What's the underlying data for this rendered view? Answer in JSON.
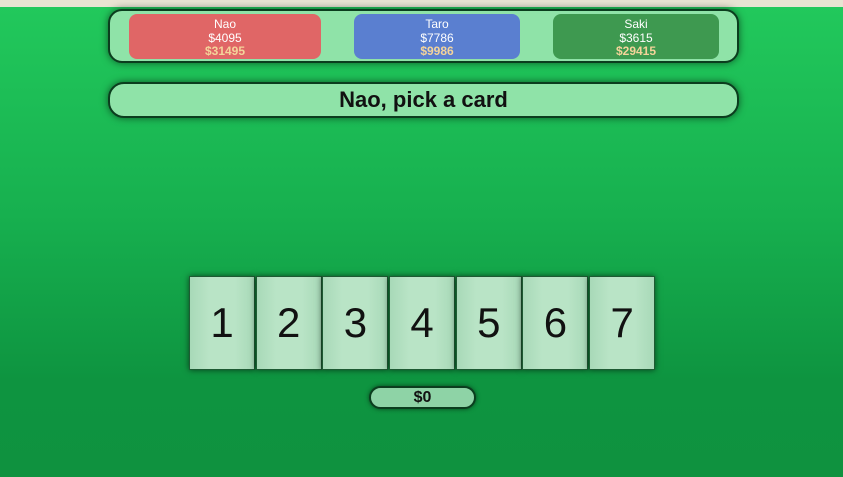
{
  "players": [
    {
      "name": "Nao",
      "cash": "$4095",
      "total": "$31495",
      "color": "#e06666"
    },
    {
      "name": "Taro",
      "cash": "$7786",
      "total": "$9986",
      "color": "#5a7fd0"
    },
    {
      "name": "Saki",
      "cash": "$3615",
      "total": "$29415",
      "color": "#3e9950"
    }
  ],
  "message": "Nao, pick a card",
  "cards": [
    "1",
    "2",
    "3",
    "4",
    "5",
    "6",
    "7"
  ],
  "bet": "$0",
  "colors": {
    "board": "#8fe3a8",
    "table_green": "#17b04f",
    "total_text": "#f4d49a"
  }
}
